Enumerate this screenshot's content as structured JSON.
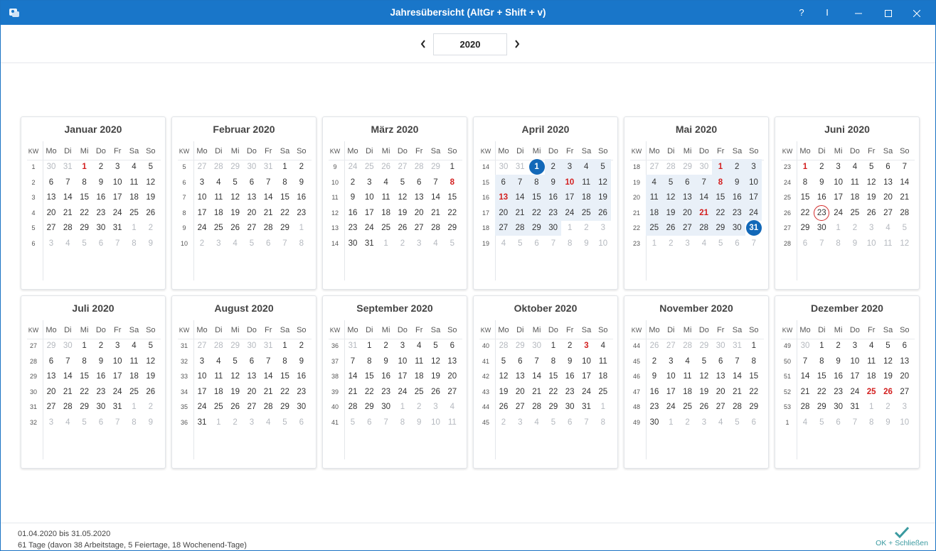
{
  "window": {
    "title": "Jahresübersicht (AltGr + Shift + v)",
    "help_label": "?",
    "text_cursor_label": "I"
  },
  "year_nav": {
    "year": "2020"
  },
  "weekday_header": {
    "kw": "KW",
    "days": [
      "Mo",
      "Di",
      "Mi",
      "Do",
      "Fr",
      "Sa",
      "So"
    ]
  },
  "months": [
    {
      "title": "Januar 2020",
      "weeks": [
        "1",
        "2",
        "3",
        "4",
        "5",
        "6"
      ],
      "first_weekday": 2,
      "days_in_month": 31,
      "prev_days": 31,
      "holidays": [
        1
      ],
      "selection": []
    },
    {
      "title": "Februar 2020",
      "weeks": [
        "5",
        "6",
        "7",
        "8",
        "9",
        "10"
      ],
      "first_weekday": 5,
      "days_in_month": 29,
      "prev_days": 31,
      "holidays": [],
      "selection": []
    },
    {
      "title": "März 2020",
      "weeks": [
        "9",
        "10",
        "11",
        "12",
        "13",
        "14"
      ],
      "first_weekday": 6,
      "days_in_month": 31,
      "prev_days": 29,
      "holidays": [
        8
      ],
      "selection": []
    },
    {
      "title": "April 2020",
      "weeks": [
        "14",
        "15",
        "16",
        "17",
        "18",
        "19"
      ],
      "first_weekday": 2,
      "days_in_month": 30,
      "prev_days": 31,
      "holidays": [
        10,
        13
      ],
      "selection": [
        1,
        30
      ],
      "endpoints": [
        1
      ]
    },
    {
      "title": "Mai 2020",
      "weeks": [
        "18",
        "19",
        "20",
        "21",
        "22",
        "23"
      ],
      "first_weekday": 4,
      "days_in_month": 31,
      "prev_days": 30,
      "holidays": [
        1,
        8,
        21
      ],
      "selection": [
        1,
        31
      ],
      "endpoints": [
        31
      ]
    },
    {
      "title": "Juni 2020",
      "weeks": [
        "23",
        "24",
        "25",
        "26",
        "27",
        "28"
      ],
      "first_weekday": 0,
      "days_in_month": 30,
      "prev_days": 31,
      "holidays": [
        1
      ],
      "selection": [],
      "today": 23
    },
    {
      "title": "Juli 2020",
      "weeks": [
        "27",
        "28",
        "29",
        "30",
        "31",
        "32"
      ],
      "first_weekday": 2,
      "days_in_month": 31,
      "prev_days": 30,
      "holidays": [],
      "selection": []
    },
    {
      "title": "August 2020",
      "weeks": [
        "31",
        "32",
        "33",
        "34",
        "35",
        "36"
      ],
      "first_weekday": 5,
      "days_in_month": 31,
      "prev_days": 31,
      "holidays": [],
      "selection": []
    },
    {
      "title": "September 2020",
      "weeks": [
        "36",
        "37",
        "38",
        "39",
        "40",
        "41"
      ],
      "first_weekday": 1,
      "days_in_month": 30,
      "prev_days": 31,
      "holidays": [],
      "selection": []
    },
    {
      "title": "Oktober 2020",
      "weeks": [
        "40",
        "41",
        "42",
        "43",
        "44",
        "45"
      ],
      "first_weekday": 3,
      "days_in_month": 31,
      "prev_days": 30,
      "holidays": [
        3
      ],
      "selection": []
    },
    {
      "title": "November 2020",
      "weeks": [
        "44",
        "45",
        "46",
        "47",
        "48",
        "49"
      ],
      "first_weekday": 6,
      "days_in_month": 30,
      "prev_days": 31,
      "holidays": [],
      "selection": []
    },
    {
      "title": "Dezember 2020",
      "weeks": [
        "49",
        "50",
        "51",
        "52",
        "53",
        "1"
      ],
      "first_weekday": 1,
      "days_in_month": 31,
      "prev_days": 30,
      "holidays": [
        25,
        26
      ],
      "selection": []
    }
  ],
  "status": {
    "range": "01.04.2020 bis 31.05.2020",
    "summary": "61 Tage (davon 38 Arbeitstage, 5 Feiertage, 18 Wochenend-Tage)"
  },
  "ok_button": {
    "label": "OK + Schließen"
  },
  "colors": {
    "titlebar": "#1976c9",
    "holiday": "#d31f1f",
    "selection": "#e9f0f8",
    "endpoint": "#1268b8",
    "ok": "#3a9aa0"
  }
}
